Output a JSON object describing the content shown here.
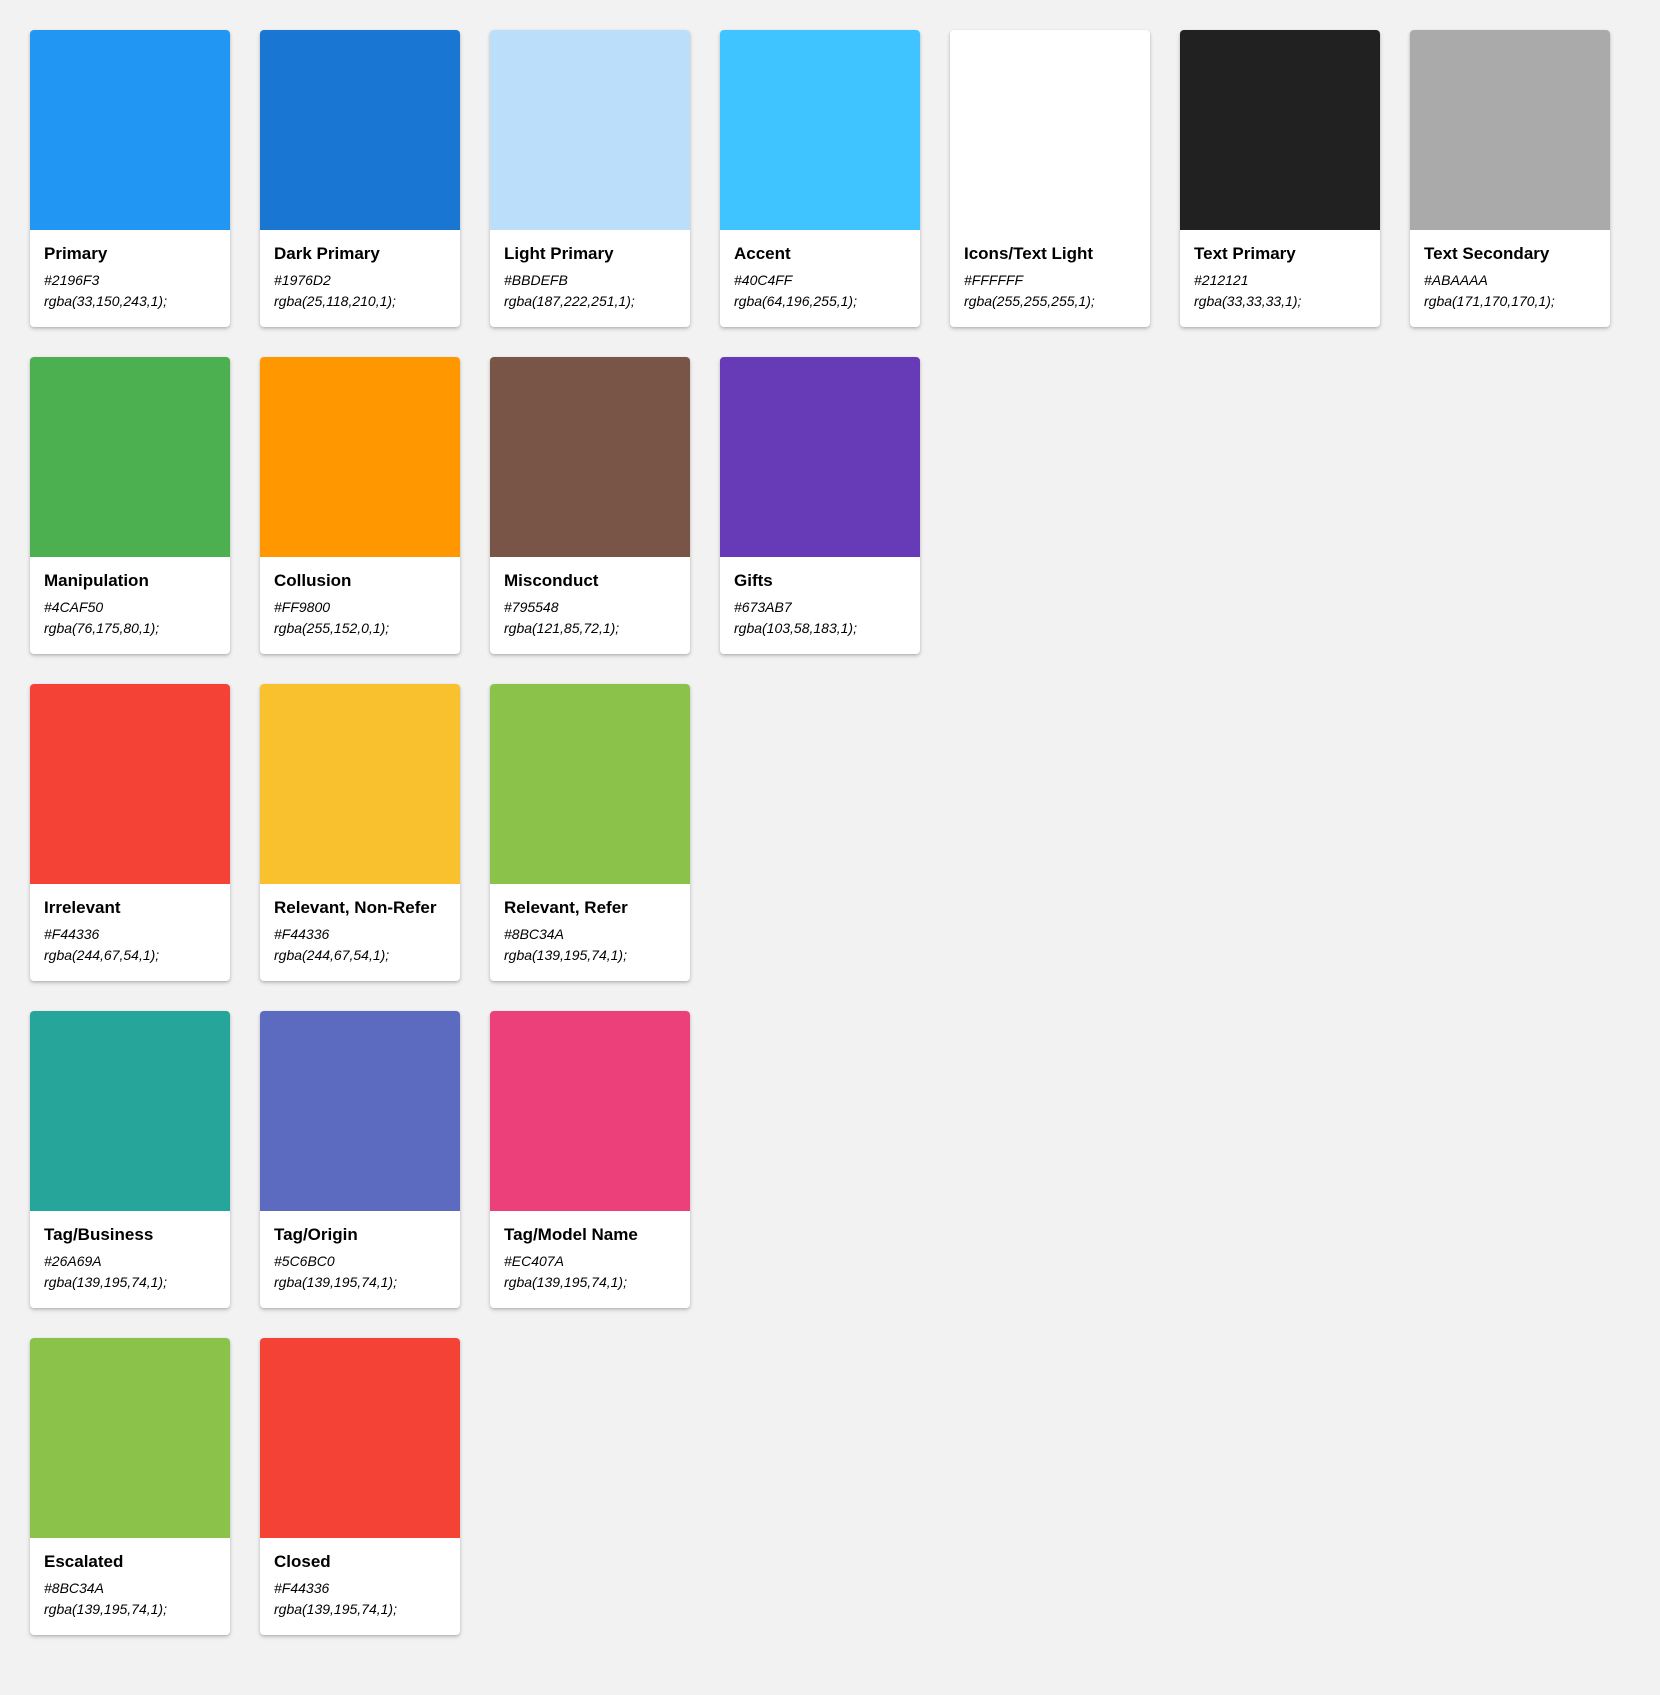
{
  "rows": [
    [
      {
        "name": "Primary",
        "hex": "#2196F3",
        "rgba": "rgba(33,150,243,1);",
        "color": "#2196F3"
      },
      {
        "name": "Dark Primary",
        "hex": "#1976D2",
        "rgba": "rgba(25,118,210,1);",
        "color": "#1976D2"
      },
      {
        "name": "Light Primary",
        "hex": "#BBDEFB",
        "rgba": "rgba(187,222,251,1);",
        "color": "#BBDEFB"
      },
      {
        "name": "Accent",
        "hex": "#40C4FF",
        "rgba": "rgba(64,196,255,1);",
        "color": "#40C4FF"
      },
      {
        "name": "Icons/Text Light",
        "hex": "#FFFFFF",
        "rgba": "rgba(255,255,255,1);",
        "color": "#FFFFFF"
      },
      {
        "name": "Text Primary",
        "hex": "#212121",
        "rgba": "rgba(33,33,33,1);",
        "color": "#212121"
      },
      {
        "name": "Text Secondary",
        "hex": "#ABAAAA",
        "rgba": "rgba(171,170,170,1);",
        "color": "#ABAAAA"
      }
    ],
    [
      {
        "name": "Manipulation",
        "hex": "#4CAF50",
        "rgba": "rgba(76,175,80,1);",
        "color": "#4CAF50"
      },
      {
        "name": "Collusion",
        "hex": "#FF9800",
        "rgba": "rgba(255,152,0,1);",
        "color": "#FF9800"
      },
      {
        "name": "Misconduct",
        "hex": "#795548",
        "rgba": "rgba(121,85,72,1);",
        "color": "#795548"
      },
      {
        "name": "Gifts",
        "hex": "#673AB7",
        "rgba": "rgba(103,58,183,1);",
        "color": "#673AB7"
      }
    ],
    [
      {
        "name": "Irrelevant",
        "hex": "#F44336",
        "rgba": "rgba(244,67,54,1);",
        "color": "#F44336"
      },
      {
        "name": "Relevant, Non-Refer",
        "hex": "#F44336",
        "rgba": "rgba(244,67,54,1);",
        "color": "#F9C12D"
      },
      {
        "name": "Relevant, Refer",
        "hex": "#8BC34A",
        "rgba": "rgba(139,195,74,1);",
        "color": "#8BC34A"
      }
    ],
    [
      {
        "name": "Tag/Business",
        "hex": "#26A69A",
        "rgba": "rgba(139,195,74,1);",
        "color": "#26A69A"
      },
      {
        "name": "Tag/Origin",
        "hex": "#5C6BC0",
        "rgba": "rgba(139,195,74,1);",
        "color": "#5C6BC0"
      },
      {
        "name": "Tag/Model Name",
        "hex": "#EC407A",
        "rgba": "rgba(139,195,74,1);",
        "color": "#EC407A"
      }
    ],
    [
      {
        "name": "Escalated",
        "hex": "#8BC34A",
        "rgba": "rgba(139,195,74,1);",
        "color": "#8BC34A"
      },
      {
        "name": "Closed",
        "hex": "#F44336",
        "rgba": "rgba(139,195,74,1);",
        "color": "#F44336"
      }
    ]
  ]
}
